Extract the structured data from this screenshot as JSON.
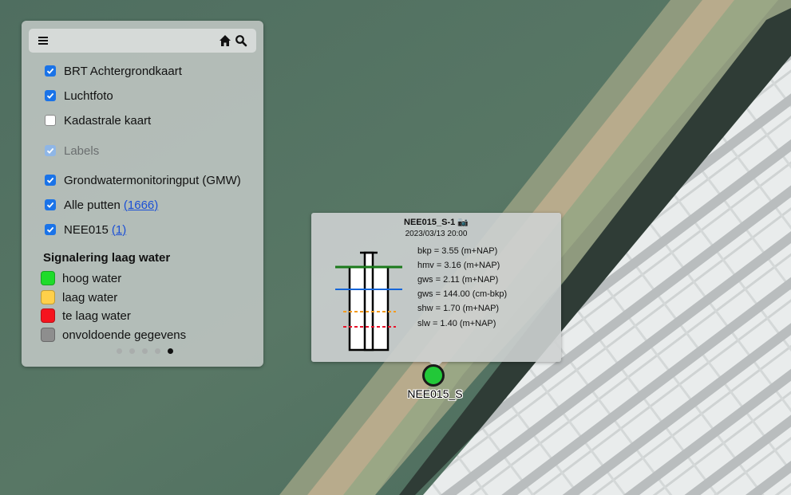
{
  "layers": {
    "brt": {
      "label": "BRT Achtergrondkaart",
      "checked": true
    },
    "luchtfoto": {
      "label": "Luchtfoto",
      "checked": true
    },
    "kadastraal": {
      "label": "Kadastrale kaart",
      "checked": false
    },
    "labels": {
      "label": "Labels",
      "checked": true,
      "disabled": true
    },
    "gmw": {
      "label": "Grondwatermonitoringput (GMW)",
      "checked": true
    },
    "alle_putten": {
      "label": "Alle putten",
      "count": "(1666)",
      "checked": true
    },
    "nee015": {
      "label": "NEE015",
      "count": "(1)",
      "checked": true
    }
  },
  "legend": {
    "title": "Signalering laag water",
    "items": [
      {
        "label": "hoog water",
        "color": "#1fdc2a"
      },
      {
        "label": "laag water",
        "color": "#ffd04a"
      },
      {
        "label": "te laag water",
        "color": "#f5141e"
      },
      {
        "label": "onvoldoende gegevens",
        "color": "#8e8e8e"
      }
    ]
  },
  "toolbar": {
    "menu_icon": "hamburger-menu-icon",
    "home_icon": "home-icon",
    "search_icon": "search-icon"
  },
  "pager": {
    "total": 5,
    "active": 4
  },
  "popup": {
    "title": "NEE015_S-1 📷",
    "date": "2023/03/13 20:00",
    "measurements": [
      {
        "text": "bkp = 3.55 (m+NAP)",
        "color": "#1b7a1b"
      },
      {
        "text": "hmv = 3.16 (m+NAP)",
        "color": "#1565d8"
      },
      {
        "text": "gws = 2.11 (m+NAP)",
        "color": "#1565d8"
      },
      {
        "text": "gws = 144.00 (cm-bkp)",
        "color": "#f39a1e"
      },
      {
        "text": "shw = 1.70 (m+NAP)",
        "color": "#f39a1e"
      },
      {
        "text": "slw = 1.40 (m+NAP)",
        "color": "#e8132a"
      }
    ]
  },
  "marker": {
    "label": "NEE015_S",
    "color": "#22c838"
  }
}
